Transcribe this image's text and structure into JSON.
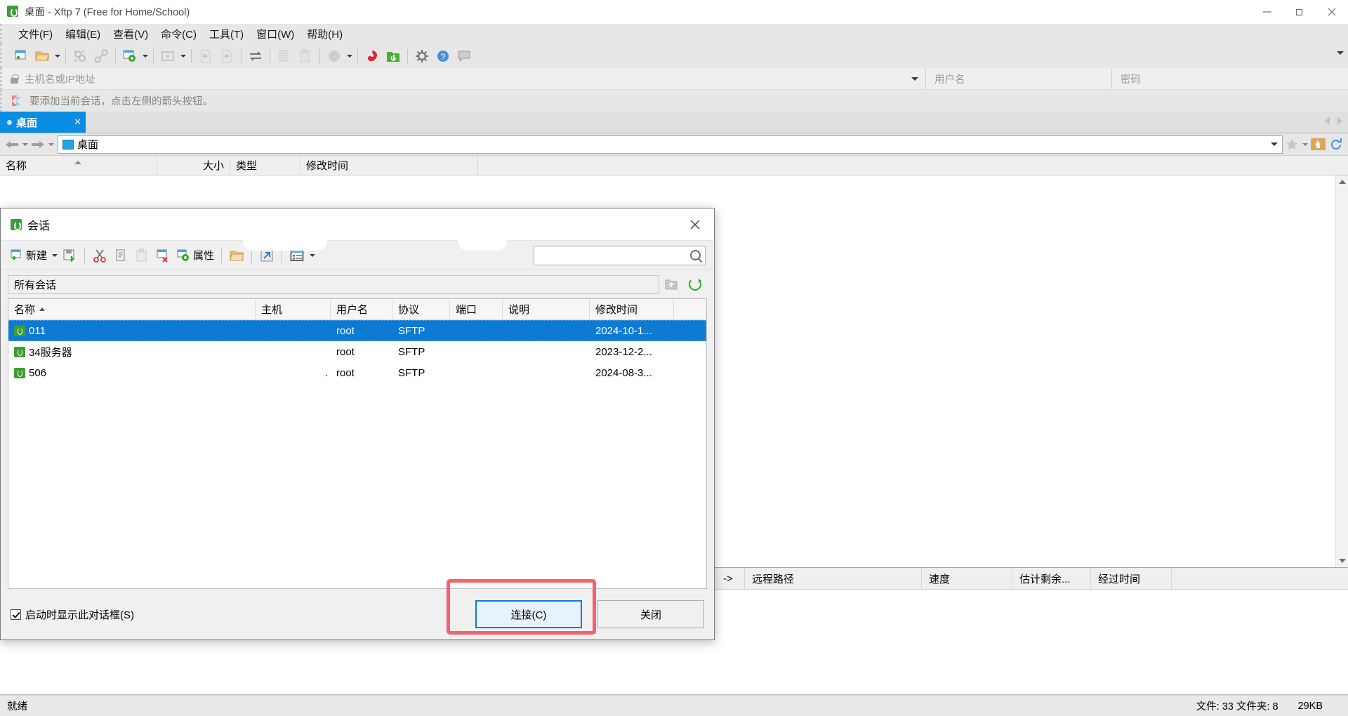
{
  "window": {
    "title_doc": "桌面",
    "title_rest": " - Xftp 7 (Free for Home/School)",
    "app_icon": "xftp-logo-icon",
    "minimize": "—",
    "maximize": "▢",
    "close": "✕"
  },
  "menubar": {
    "items": [
      {
        "label": "文件(F)",
        "name": "menu-file"
      },
      {
        "label": "编辑(E)",
        "name": "menu-edit"
      },
      {
        "label": "查看(V)",
        "name": "menu-view"
      },
      {
        "label": "命令(C)",
        "name": "menu-command"
      },
      {
        "label": "工具(T)",
        "name": "menu-tools"
      },
      {
        "label": "窗口(W)",
        "name": "menu-window"
      },
      {
        "label": "帮助(H)",
        "name": "menu-help"
      }
    ]
  },
  "toolbar": {
    "icons": [
      "new-session-icon",
      "open-folder-icon",
      "disconnect-icon",
      "link-icon",
      "session-properties-icon",
      "run-icon",
      "download-icon",
      "upload-icon",
      "sync-transfer-icon",
      "copy-icon",
      "paste-icon",
      "circle-menu-icon",
      "xshell-icon",
      "xftp-icon",
      "settings-icon",
      "help-icon",
      "comment-icon"
    ],
    "overflow": "▾"
  },
  "connbar": {
    "host_placeholder": "主机名或IP地址",
    "host_value": "",
    "user_placeholder": "用户名",
    "user_value": "",
    "password_placeholder": "密码",
    "password_value": "",
    "lock_icon": "lock-icon",
    "dropdown_icon": "chevron-down-icon"
  },
  "hintbar": {
    "text": "要添加当前会话，点击左侧的箭头按钮。",
    "icon": "flag-icon"
  },
  "tabs": {
    "items": [
      {
        "label": "桌面",
        "close": "✕"
      }
    ],
    "scroll_left": "◀",
    "scroll_right": "▶"
  },
  "pathbar": {
    "back_icon": "arrow-left-icon",
    "forward_icon": "arrow-right-icon",
    "folder_icon": "folder-blue-icon",
    "path": "桌面",
    "dropdown_icon": "chevron-down-icon",
    "star_icon": "star-icon",
    "home_icon": "home-upload-icon",
    "refresh_icon": "refresh-icon"
  },
  "local_columns": [
    {
      "label": "名称",
      "name": "col-name"
    },
    {
      "label": "大小",
      "name": "col-size"
    },
    {
      "label": "类型",
      "name": "col-type"
    },
    {
      "label": "修改时间",
      "name": "col-modified"
    }
  ],
  "transfer_columns": [
    {
      "label": "->",
      "name": "col-direction"
    },
    {
      "label": "远程路径",
      "name": "col-remote-path"
    },
    {
      "label": "速度",
      "name": "col-speed"
    },
    {
      "label": "估计剩余...",
      "name": "col-eta"
    },
    {
      "label": "经过时间",
      "name": "col-elapsed"
    }
  ],
  "statusbar": {
    "ready": "就绪",
    "counts": "文件: 33  文件夹: 8",
    "size": "29KB"
  },
  "dialog": {
    "title": "会话",
    "icon": "xftp-logo-icon",
    "close_icon": "close-icon",
    "toolbar": {
      "new_label": "新建",
      "new_icon": "new-session-icon",
      "new_dropdown": "▾",
      "save_icon": "save-icon",
      "cut_icon": "cut-icon",
      "copy_icon": "copy-icon",
      "paste_icon": "paste-icon",
      "delete_icon": "delete-icon",
      "properties_icon": "properties-icon",
      "properties_label": "属性",
      "open_folder_icon": "open-folder-icon",
      "shortcut_icon": "create-shortcut-icon",
      "view_icon": "view-mode-icon",
      "view_dropdown": "▾",
      "search_value": "",
      "search_icon": "search-icon"
    },
    "folderbar": {
      "value": "所有会话",
      "up_icon": "folder-up-icon",
      "refresh_icon": "refresh-icon"
    },
    "list": {
      "columns": [
        {
          "label": "名称",
          "name": "col-name",
          "sort": "asc"
        },
        {
          "label": "主机",
          "name": "col-host"
        },
        {
          "label": "用户名",
          "name": "col-username"
        },
        {
          "label": "协议",
          "name": "col-protocol"
        },
        {
          "label": "端口",
          "name": "col-port"
        },
        {
          "label": "说明",
          "name": "col-description"
        },
        {
          "label": "修改时间",
          "name": "col-modified"
        }
      ],
      "rows": [
        {
          "name": "011",
          "host": "",
          "username": "root",
          "protocol": "SFTP",
          "port": "",
          "description": "",
          "modified": "2024-10-1...",
          "selected": true
        },
        {
          "name": "34服务器",
          "host": "",
          "username": "root",
          "protocol": "SFTP",
          "port": "",
          "description": "",
          "modified": "2023-12-2...",
          "selected": false
        },
        {
          "name": "506",
          "host": ".",
          "username": "root",
          "protocol": "SFTP",
          "port": "",
          "description": "",
          "modified": "2024-08-3...",
          "selected": false
        }
      ]
    },
    "footer": {
      "checkbox_label": "启动时显示此对话框(S)",
      "checkbox_checked": true,
      "connect_label": "连接(C)",
      "close_label": "关闭"
    }
  },
  "colors": {
    "accent": "#0d7bd4",
    "tab_active": "#0b8de3",
    "highlight": "#f4626e",
    "chrome": "#e7e7e7",
    "green": "#3f9c35"
  }
}
